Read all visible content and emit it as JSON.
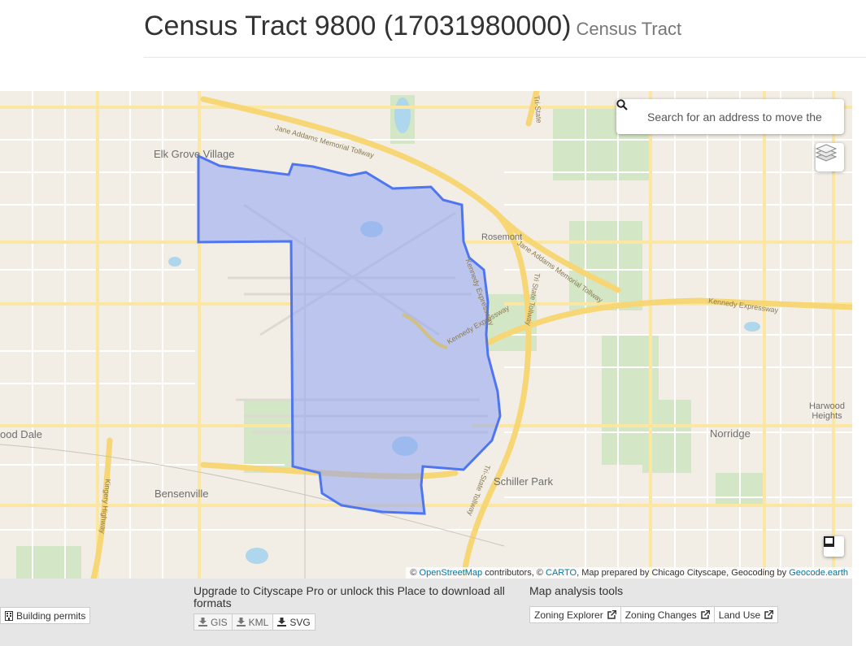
{
  "header": {
    "title": "Census Tract 9800 (17031980000)",
    "subtitle": "Census Tract"
  },
  "map": {
    "search_placeholder": "Search for an address to move the",
    "labels": {
      "elk_grove": "Elk Grove Village",
      "rosemont": "Rosemont",
      "wood_dale": "ood Dale",
      "bensenville": "Bensenville",
      "schiller_park": "Schiller Park",
      "norridge": "Norridge",
      "harwood_heights": "Harwood Heights"
    },
    "road_labels": {
      "jane_addams_1": "Jane Addams Memorial Tollway",
      "jane_addams_2": "Jane Addams Memorial Tollway",
      "kennedy_1": "Kennedy Expressway",
      "kennedy_2": "Kennedy Expressway",
      "kennedy_3": "Kennedy Expressway",
      "tri_state_1": "Tri-State",
      "tri_state_2": "Tri State Tollway",
      "tri_state_3": "Tri-State Tollway",
      "kingery": "Kingery Highway"
    },
    "attribution": {
      "prefix": "©",
      "osm": "OpenStreetMap",
      "contributors": "contributors, ©",
      "carto": "CARTO",
      "prepared": ", Map prepared by Chicago Cityscape, Geocoding by",
      "geocode": "Geocode.earth"
    },
    "colors": {
      "tract_fill": "#8fa4f2",
      "tract_stroke": "#4f76f0",
      "road": "#fde99a",
      "highway": "#f7d873",
      "park": "#cfe3c0",
      "water": "#a9d3ea"
    }
  },
  "footer": {
    "building_permits": "Building permits",
    "download_text": "Upgrade to Cityscape Pro or unlock this Place to download all formats",
    "gis": "GIS",
    "kml": "KML",
    "svg": "SVG",
    "analysis_title": "Map analysis tools",
    "zoning_explorer": "Zoning Explorer",
    "zoning_changes": "Zoning Changes",
    "land_use": "Land Use"
  }
}
